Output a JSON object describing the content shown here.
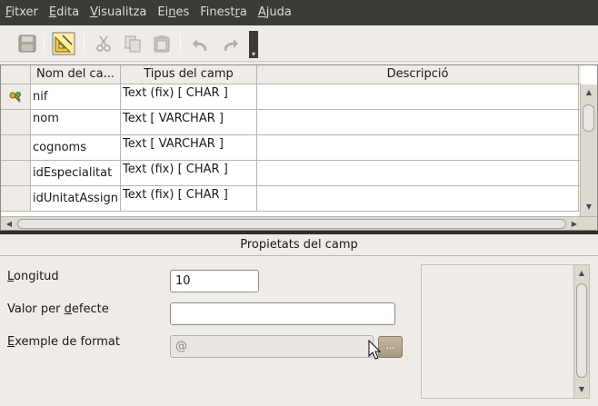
{
  "menu": {
    "items": [
      {
        "pre": "",
        "u": "F",
        "post": "itxer"
      },
      {
        "pre": "",
        "u": "E",
        "post": "dita"
      },
      {
        "pre": "",
        "u": "V",
        "post": "isualitza"
      },
      {
        "pre": "Ei",
        "u": "n",
        "post": "es"
      },
      {
        "pre": "Finest",
        "u": "r",
        "post": "a"
      },
      {
        "pre": "",
        "u": "A",
        "post": "juda"
      }
    ]
  },
  "toolbar": {
    "buttons": [
      {
        "name": "save-icon"
      },
      {
        "name": "design-icon"
      },
      {
        "name": "cut-icon"
      },
      {
        "name": "copy-icon"
      },
      {
        "name": "paste-icon"
      },
      {
        "name": "undo-icon"
      },
      {
        "name": "redo-icon"
      }
    ]
  },
  "table": {
    "headers": [
      "Nom del ca...",
      "Tipus del camp",
      "Descripció"
    ],
    "rows": [
      {
        "name": "nif",
        "type": "Text (fix) [ CHAR ]",
        "key": true
      },
      {
        "name": "nom",
        "type": "Text [ VARCHAR ]",
        "key": false
      },
      {
        "name": "cognoms",
        "type": "Text [ VARCHAR ]",
        "key": false
      },
      {
        "name": "idEspecialitat",
        "type": "Text (fix) [ CHAR ]",
        "key": false
      },
      {
        "name": "idUnitatAssign",
        "type": "Text (fix) [ CHAR ]",
        "key": false
      }
    ]
  },
  "properties": {
    "title": "Propietats del camp",
    "longitud": {
      "pre": "",
      "u": "L",
      "post": "ongitud",
      "value": "10"
    },
    "valor": {
      "pre": "Valor per ",
      "u": "d",
      "post": "efecte",
      "value": ""
    },
    "exemple": {
      "pre": "",
      "u": "E",
      "post": "xemple de format",
      "value": "@"
    },
    "dots_label": "..."
  },
  "colors": {
    "menubar": "#3c3b37",
    "background": "#efebe7"
  }
}
